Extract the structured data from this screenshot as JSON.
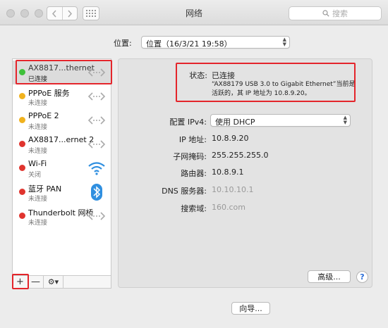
{
  "window": {
    "title": "网络"
  },
  "toolbar": {
    "back": "<",
    "forward": ">",
    "search_placeholder": "搜索"
  },
  "location": {
    "label": "位置:",
    "value": "位置（16/3/21 19:58）"
  },
  "services": [
    {
      "name": "AX8817...thernet",
      "status": "已连接",
      "color": "#3fc13a",
      "icon": "ethernet-icon"
    },
    {
      "name": "PPPoE 服务",
      "status": "未连接",
      "color": "#f0b21e",
      "icon": "ethernet-icon"
    },
    {
      "name": "PPPoE 2",
      "status": "未连接",
      "color": "#f0b21e",
      "icon": "ethernet-icon"
    },
    {
      "name": "AX8817...ernet 2",
      "status": "未连接",
      "color": "#e0342e",
      "icon": "ethernet-icon"
    },
    {
      "name": "Wi-Fi",
      "status": "关闭",
      "color": "#e0342e",
      "icon": "wifi-icon"
    },
    {
      "name": "蓝牙 PAN",
      "status": "未连接",
      "color": "#e0342e",
      "icon": "bluetooth-icon"
    },
    {
      "name": "Thunderbolt 网桥",
      "status": "未连接",
      "color": "#e0342e",
      "icon": "ethernet-icon"
    }
  ],
  "sidebar_footer": {
    "add": "+",
    "remove": "—",
    "action": "⚙▾"
  },
  "detail": {
    "status_label": "状态:",
    "status_value": "已连接",
    "status_desc": "“AX88179 USB 3.0 to Gigabit Ethernet”当前是活跃的，其 IP 地址为 10.8.9.20。",
    "ipv4_label": "配置 IPv4:",
    "ipv4_value": "使用 DHCP",
    "ip_label": "IP 地址:",
    "ip_value": "10.8.9.20",
    "mask_label": "子网掩码:",
    "mask_value": "255.255.255.0",
    "router_label": "路由器:",
    "router_value": "10.8.9.1",
    "dns_label": "DNS 服务器:",
    "dns_value": "10.10.10.1",
    "search_label": "搜索域:",
    "search_value": "160.com"
  },
  "buttons": {
    "advanced": "高级...",
    "help": "?",
    "assist": "向导..."
  },
  "colors": {
    "highlight": "#e4252b",
    "accent": "#2b6ed8"
  }
}
